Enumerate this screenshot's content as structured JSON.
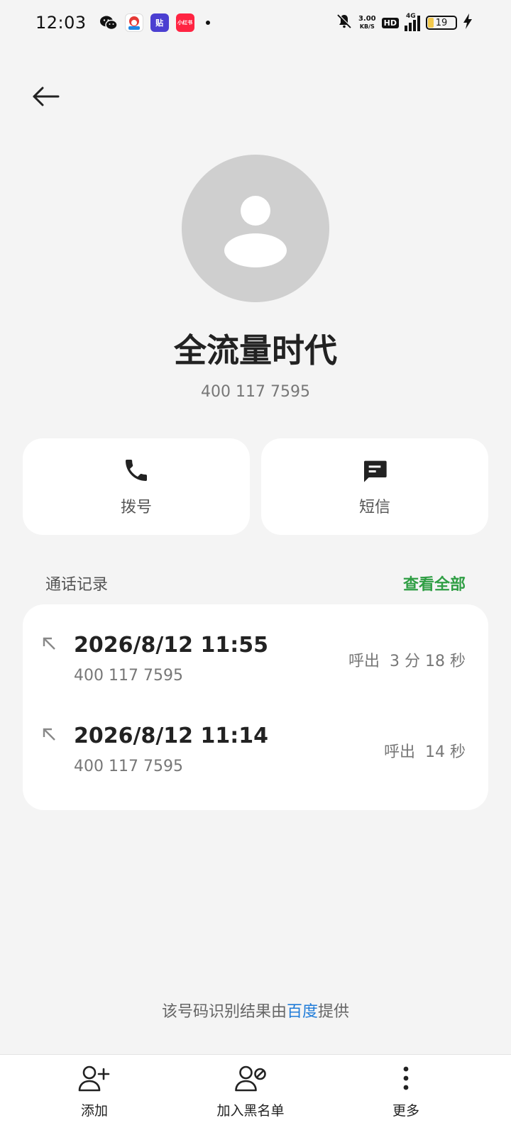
{
  "status_bar": {
    "time": "12:03",
    "net_speed_value": "3.00",
    "net_speed_unit": "KB/S",
    "hd_label": "HD",
    "network_type": "4G",
    "battery_level": "19",
    "tieba_label": "贴",
    "xhs_label": "小红书"
  },
  "header": {
    "back_icon": "back-arrow-icon"
  },
  "contact": {
    "name": "全流量时代",
    "number": "400 117 7595"
  },
  "actions": {
    "call_label": "拨号",
    "sms_label": "短信"
  },
  "call_log": {
    "title": "通话记录",
    "view_all": "查看全部",
    "entries": [
      {
        "time": "2026/8/12 11:55",
        "number": "400 117 7595",
        "status": "呼出  3 分 18 秒"
      },
      {
        "time": "2026/8/12 11:14",
        "number": "400 117 7595",
        "status": "呼出  14 秒"
      }
    ]
  },
  "attribution": {
    "prefix": "该号码识别结果由",
    "link": "百度",
    "suffix": "提供"
  },
  "toolbar": {
    "add_label": "添加",
    "blacklist_label": "加入黑名单",
    "more_label": "更多"
  },
  "colors": {
    "accent_green": "#2f9e44",
    "link_blue": "#1f7bd8",
    "background": "#f4f4f4"
  }
}
